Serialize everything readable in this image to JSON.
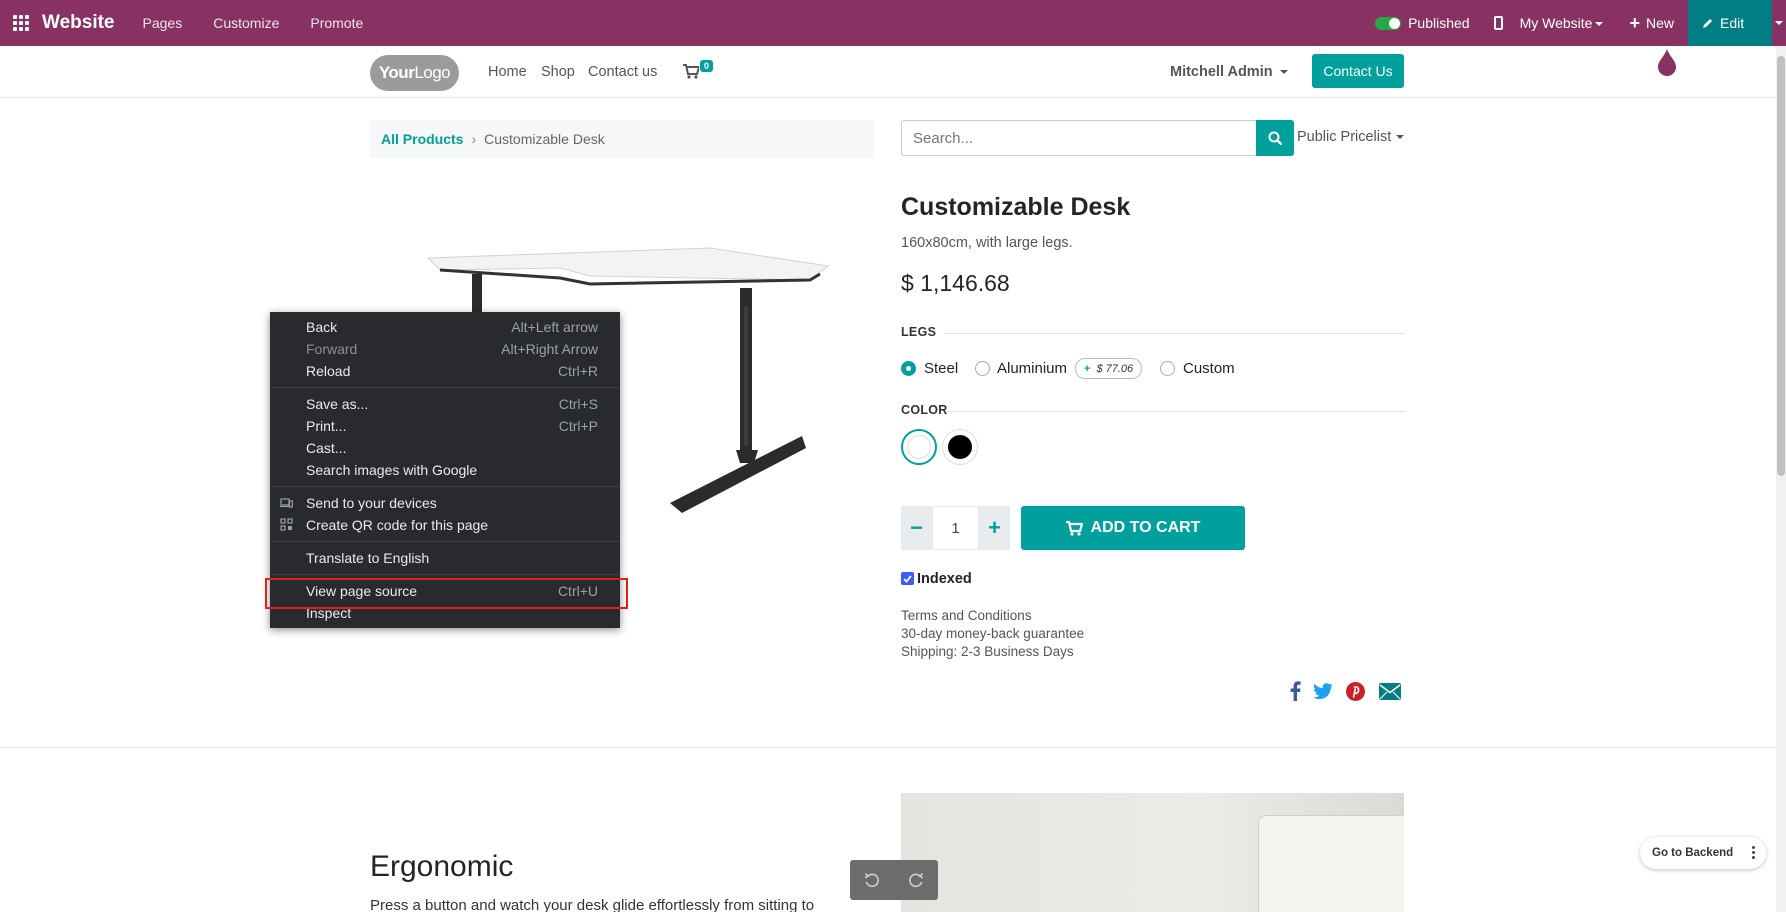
{
  "topbar": {
    "brand": "Website",
    "menus": [
      "Pages",
      "Customize",
      "Promote"
    ],
    "published_label": "Published",
    "my_website_label": "My Website",
    "new_label": "New",
    "edit_label": "Edit"
  },
  "header": {
    "logo_text_a": "Your",
    "logo_text_b": "Logo",
    "nav": [
      "Home",
      "Shop",
      "Contact us"
    ],
    "cart_count": "0",
    "user_name": "Mitchell Admin",
    "contact_button": "Contact Us"
  },
  "breadcrumb": {
    "root": "All Products",
    "current": "Customizable Desk"
  },
  "search": {
    "placeholder": "Search...",
    "pricelist": "Public Pricelist"
  },
  "product": {
    "title": "Customizable Desk",
    "subtitle": "160x80cm, with large legs.",
    "price": "$ 1,146.68",
    "legs_label": "LEGS",
    "legs_options": [
      "Steel",
      "Aluminium",
      "Custom"
    ],
    "legs_selected": "Steel",
    "aluminium_extra_sign": "+",
    "aluminium_extra": "$ 77.06",
    "color_label": "COLOR",
    "colors": [
      "#ffffff",
      "#000000"
    ],
    "quantity": "1",
    "add_to_cart": "ADD TO CART",
    "indexed_label": "Indexed",
    "terms": [
      "Terms and Conditions",
      "30-day money-back guarantee",
      "Shipping: 2-3 Business Days"
    ],
    "social_icons": [
      "facebook-icon",
      "twitter-icon",
      "pinterest-icon",
      "email-icon"
    ]
  },
  "section": {
    "heading": "Ergonomic",
    "description": "Press a button and watch your desk glide effortlessly from sitting to"
  },
  "floating": {
    "go_to_backend": "Go to Backend"
  },
  "context_menu": {
    "items": [
      {
        "label": "Back",
        "shortcut": "Alt+Left arrow"
      },
      {
        "label": "Forward",
        "shortcut": "Alt+Right Arrow"
      },
      {
        "label": "Reload",
        "shortcut": "Ctrl+R"
      },
      {
        "label": "Save as...",
        "shortcut": "Ctrl+S"
      },
      {
        "label": "Print...",
        "shortcut": "Ctrl+P"
      },
      {
        "label": "Cast...",
        "shortcut": ""
      },
      {
        "label": "Search images with Google",
        "shortcut": ""
      },
      {
        "label": "Send to your devices",
        "shortcut": ""
      },
      {
        "label": "Create QR code for this page",
        "shortcut": ""
      },
      {
        "label": "Translate to English",
        "shortcut": ""
      },
      {
        "label": "View page source",
        "shortcut": "Ctrl+U"
      },
      {
        "label": "Inspect",
        "shortcut": ""
      }
    ],
    "highlighted": "View page source"
  },
  "colors": {
    "topbar": "#873262",
    "accent": "#00a09d",
    "edit": "#017e84",
    "menu_bg": "#292a2d",
    "highlight_box": "#e0201a"
  }
}
